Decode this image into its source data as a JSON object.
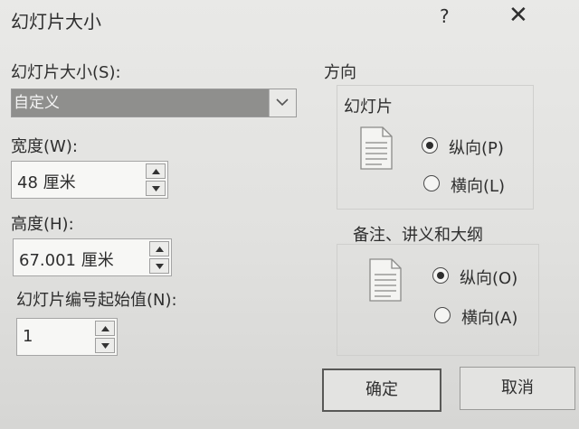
{
  "dialog": {
    "title": "幻灯片大小",
    "help": "?",
    "close": "✕"
  },
  "size": {
    "label": "幻灯片大小(S):",
    "selected": "自定义"
  },
  "width": {
    "label": "宽度(W):",
    "value": "48 厘米"
  },
  "height": {
    "label": "高度(H):",
    "value": "67.001 厘米"
  },
  "numbering": {
    "label": "幻灯片编号起始值(N):",
    "value": "1"
  },
  "orientation": {
    "heading": "方向",
    "slides": {
      "heading": "幻灯片",
      "portrait": "纵向(P)",
      "landscape": "横向(L)",
      "selected": "portrait"
    },
    "notes": {
      "heading": "备注、讲义和大纲",
      "portrait": "纵向(O)",
      "landscape": "横向(A)",
      "selected": "portrait"
    }
  },
  "buttons": {
    "ok": "确定",
    "cancel": "取消"
  }
}
